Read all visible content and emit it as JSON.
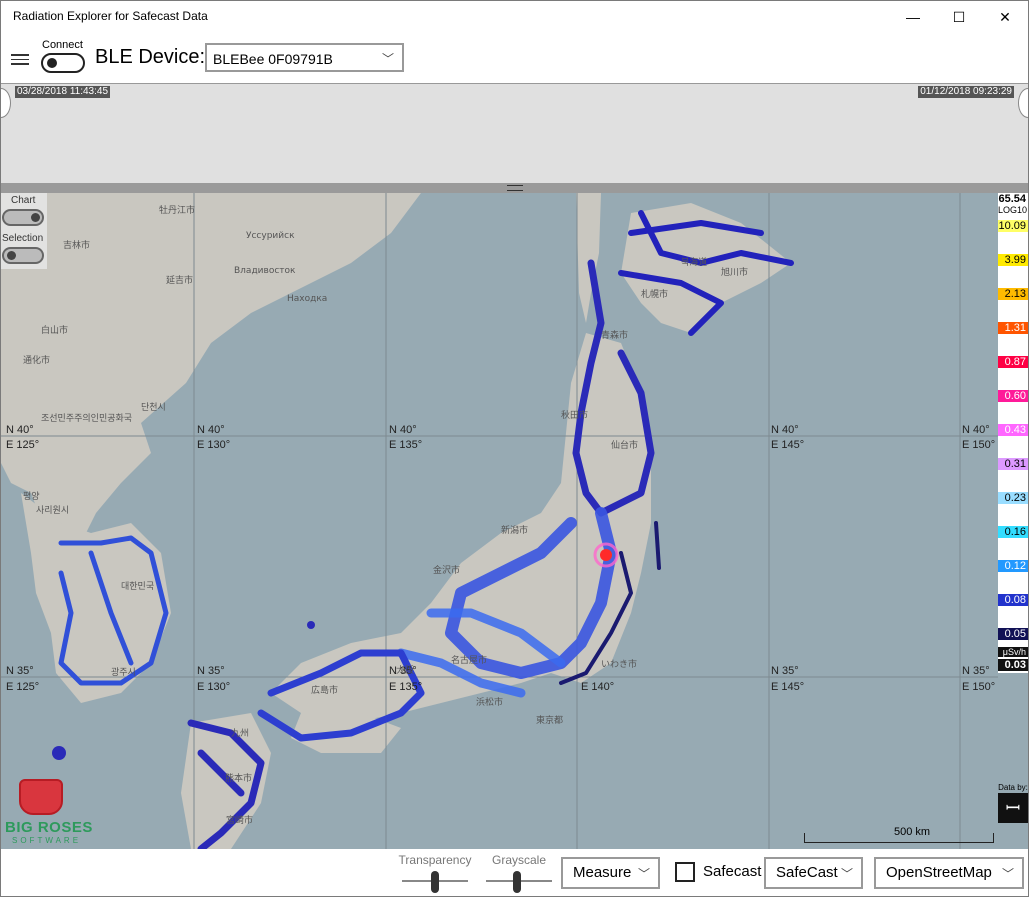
{
  "window": {
    "title": "Radiation Explorer for Safecast Data",
    "minimize": "—",
    "maximize": "☐",
    "close": "✕"
  },
  "toolbar": {
    "connect_label": "Connect",
    "ble_label": "BLE Device:",
    "ble_value": "BLEBee 0F09791B"
  },
  "timeline": {
    "start": "03/28/2018 11:43:45",
    "end": "01/12/2018 09:23:29"
  },
  "map_toggles": {
    "chart_label": "Chart",
    "selection_label": "Selection"
  },
  "legend": {
    "top": "65.54",
    "scale": "LOG10",
    "values": [
      "10.09",
      "3.99",
      "2.13",
      "1.31",
      "0.87",
      "0.60",
      "0.43",
      "0.31",
      "0.23",
      "0.16",
      "0.12",
      "0.08",
      "0.05"
    ],
    "unit": "μSv/h",
    "bottom": "0.03"
  },
  "grid_labels": {
    "n40": "N 40°",
    "n35": "N 35°",
    "e125": "E 125°",
    "e130": "E 130°",
    "e135": "E 135°",
    "e140": "E 140°",
    "e145": "E 145°",
    "e150": "E 150°"
  },
  "place_labels": [
    "牡丹江市",
    "吉林市",
    "延吉市",
    "Владивосток",
    "Уссурийск",
    "Находка",
    "白山市",
    "通化市",
    "단천시",
    "조선민주주의인민공화국",
    "평양",
    "사리원시",
    "대한민국",
    "광주시",
    "북海道",
    "札幌市",
    "旭川市",
    "青森市",
    "仙台市",
    "秋田市",
    "新潟市",
    "金沢市",
    "東京都",
    "名古屋市",
    "浜松市",
    "大阪",
    "広島市",
    "九州",
    "熊本市",
    "宮崎市",
    "いわき市"
  ],
  "scale": {
    "label": "500 km"
  },
  "attribution": {
    "data_by": "Data by:",
    "source": "SAFECAST"
  },
  "logo": {
    "line1": "BIG ROSES",
    "line2": "SOFTWARE"
  },
  "bottom": {
    "transparency_label": "Transparency",
    "transparency_value": 0.5,
    "grayscale_label": "Grayscale",
    "grayscale_value": 0.5,
    "measure_value": "Measure",
    "safecast_check_label": "Safecast",
    "safecast_checked": false,
    "source_value": "SafeCast",
    "basemap_value": "OpenStreetMap"
  },
  "colors": {
    "accent_dark": "#222222",
    "sea": "#97aab3",
    "land": "#c9c7c0",
    "track_low": "#1a1aa8",
    "track_mid": "#3b6bf0",
    "track_high": "#ff2a2a"
  }
}
